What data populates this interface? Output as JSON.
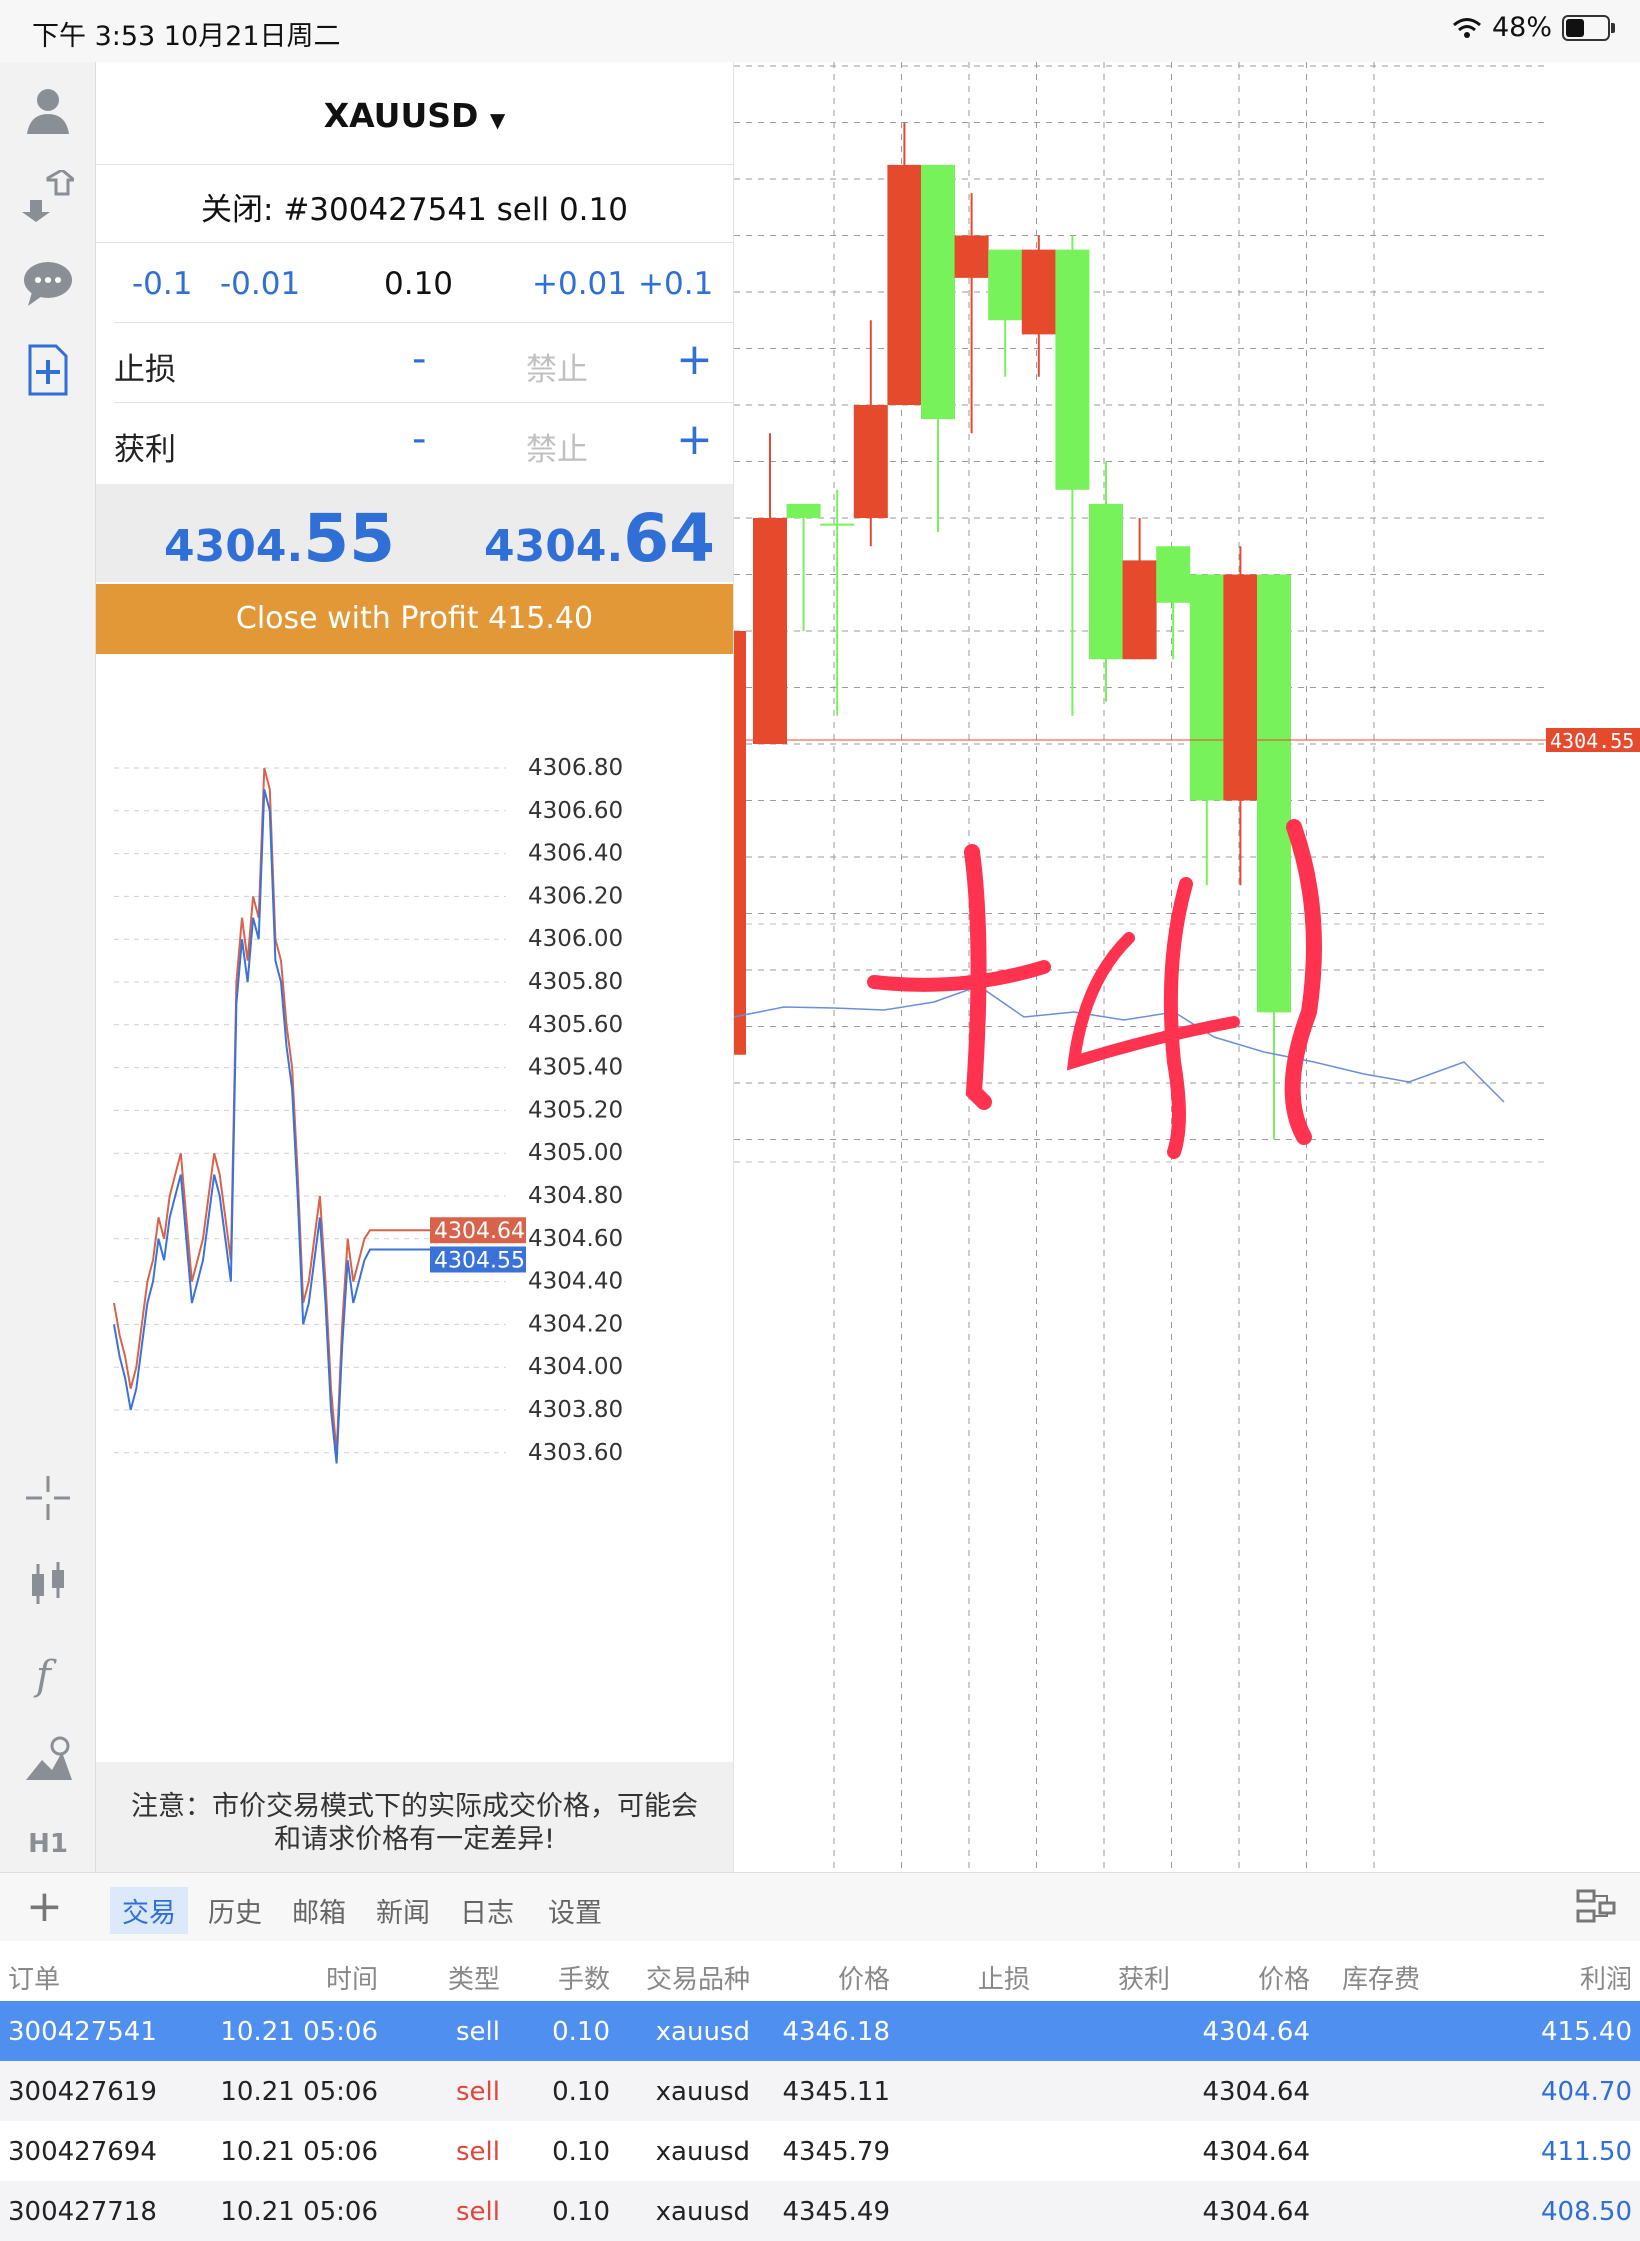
{
  "status_bar": {
    "time": "下午 3:53   10月21日周二",
    "battery_pct": "48%"
  },
  "toolbar": {
    "timeframe": "H1"
  },
  "order": {
    "symbol": "XAUUSD",
    "close_line": "关闭: #300427541 sell 0.10",
    "volume": {
      "dec_large": "-0.1",
      "dec_small": "-0.01",
      "value": "0.10",
      "inc_small": "+0.01",
      "inc_large": "+0.1"
    },
    "stop_loss": {
      "label": "止损",
      "minus": "-",
      "value": "禁止",
      "plus": "+"
    },
    "take_profit": {
      "label": "获利",
      "minus": "-",
      "value": "禁止",
      "plus": "+"
    },
    "bid": {
      "prefix": "4304.",
      "big": "55"
    },
    "ask": {
      "prefix": "4304.",
      "big": "64"
    },
    "close_button": "Close with Profit 415.40",
    "notice_line1": "注意：市价交易模式下的实际成交价格，可能会",
    "notice_line2": "和请求价格有一定差异!"
  },
  "tick_chart": {
    "y_ticks": [
      "4306.80",
      "4306.60",
      "4306.40",
      "4306.20",
      "4306.00",
      "4305.80",
      "4305.60",
      "4305.40",
      "4305.20",
      "4305.00",
      "4304.80",
      "4304.60",
      "4304.40",
      "4304.20",
      "4304.00",
      "4303.80",
      "4303.60"
    ],
    "ask_label": "4304.64",
    "bid_label": "4304.55",
    "ask_color": "#d9634a",
    "bid_color": "#3a72d8"
  },
  "candle_chart": {
    "price_label": "4304.55",
    "up_color": "#77f25a",
    "down_color": "#e64a2c",
    "handwriting": "+41"
  },
  "chart_data": {
    "type": "line",
    "title": "",
    "series": [
      {
        "name": "",
        "values": [
          4304.3,
          4304.15,
          4304.05,
          4303.9,
          4304.0,
          4304.2,
          4304.4,
          4304.5,
          4304.7,
          4304.6,
          4304.8,
          4304.9,
          4305.0,
          4304.7,
          4304.4,
          4304.5,
          4304.6,
          4304.8,
          4305.0,
          4304.9,
          4304.7,
          4304.5,
          4305.8,
          4306.1,
          4305.9,
          4306.2,
          4306.1,
          4306.8,
          4306.7,
          4306.0,
          4305.9,
          4305.6,
          4305.4,
          4304.9,
          4304.3,
          4304.4,
          4304.6,
          4304.8,
          4304.4,
          4303.9,
          4303.6,
          4304.2,
          4304.6,
          4304.4,
          4304.5,
          4304.6,
          4304.64
        ]
      },
      {
        "name": "",
        "values": [
          4304.2,
          4304.05,
          4303.95,
          4303.8,
          4303.9,
          4304.1,
          4304.3,
          4304.4,
          4304.6,
          4304.5,
          4304.7,
          4304.8,
          4304.9,
          4304.6,
          4304.3,
          4304.4,
          4304.5,
          4304.7,
          4304.9,
          4304.8,
          4304.6,
          4304.4,
          4305.7,
          4306.0,
          4305.8,
          4306.1,
          4306.0,
          4306.7,
          4306.6,
          4305.9,
          4305.8,
          4305.5,
          4305.3,
          4304.8,
          4304.2,
          4304.3,
          4304.5,
          4304.7,
          4304.3,
          4303.8,
          4303.55,
          4304.1,
          4304.5,
          4304.3,
          4304.4,
          4304.5,
          4304.55
        ]
      }
    ],
    "ylim": [
      4303.5,
      4306.9
    ],
    "grid": true
  },
  "candles": [
    {
      "o": 4305.9,
      "h": 4305.9,
      "l": 4304.4,
      "c": 4304.4
    },
    {
      "o": 4306.3,
      "h": 4306.6,
      "l": 4305.5,
      "c": 4305.5
    },
    {
      "o": 4306.3,
      "h": 4306.3,
      "l": 4305.9,
      "c": 4306.35
    },
    {
      "o": 4306.28,
      "h": 4306.4,
      "l": 4305.6,
      "c": 4306.28
    },
    {
      "o": 4306.7,
      "h": 4307.0,
      "l": 4306.2,
      "c": 4306.3
    },
    {
      "o": 4307.55,
      "h": 4307.7,
      "l": 4306.7,
      "c": 4306.7
    },
    {
      "o": 4306.65,
      "h": 4307.55,
      "l": 4306.25,
      "c": 4307.55
    },
    {
      "o": 4307.3,
      "h": 4307.45,
      "l": 4306.6,
      "c": 4307.15
    },
    {
      "o": 4307.0,
      "h": 4307.2,
      "l": 4306.8,
      "c": 4307.25
    },
    {
      "o": 4307.25,
      "h": 4307.3,
      "l": 4306.8,
      "c": 4306.95
    },
    {
      "o": 4306.4,
      "h": 4307.3,
      "l": 4305.6,
      "c": 4307.25
    },
    {
      "o": 4305.8,
      "h": 4306.5,
      "l": 4305.65,
      "c": 4306.35
    },
    {
      "o": 4306.15,
      "h": 4306.3,
      "l": 4305.8,
      "c": 4305.8
    },
    {
      "o": 4306.0,
      "h": 4306.2,
      "l": 4305.8,
      "c": 4306.2
    },
    {
      "o": 4305.3,
      "h": 4306.1,
      "l": 4305.0,
      "c": 4306.1
    },
    {
      "o": 4306.1,
      "h": 4306.2,
      "l": 4305.0,
      "c": 4305.3
    },
    {
      "o": 4304.55,
      "h": 4306.1,
      "l": 4304.1,
      "c": 4306.1
    }
  ],
  "tabs": [
    "交易",
    "历史",
    "邮箱",
    "新闻",
    "日志",
    "设置"
  ],
  "table": {
    "headers": [
      "订单",
      "时间",
      "类型",
      "手数",
      "交易品种",
      "价格",
      "止损",
      "获利",
      "价格",
      "库存费",
      "利润"
    ],
    "rows": [
      {
        "order": "300427541",
        "time": "10.21 05:06",
        "type": "sell",
        "lots": "0.10",
        "symbol": "xauusd",
        "open": "4346.18",
        "sl": "",
        "tp": "",
        "price": "4304.64",
        "swap": "",
        "profit": "415.40",
        "selected": true
      },
      {
        "order": "300427619",
        "time": "10.21 05:06",
        "type": "sell",
        "lots": "0.10",
        "symbol": "xauusd",
        "open": "4345.11",
        "sl": "",
        "tp": "",
        "price": "4304.64",
        "swap": "",
        "profit": "404.70",
        "selected": false
      },
      {
        "order": "300427694",
        "time": "10.21 05:06",
        "type": "sell",
        "lots": "0.10",
        "symbol": "xauusd",
        "open": "4345.79",
        "sl": "",
        "tp": "",
        "price": "4304.64",
        "swap": "",
        "profit": "411.50",
        "selected": false
      },
      {
        "order": "300427718",
        "time": "10.21 05:06",
        "type": "sell",
        "lots": "0.10",
        "symbol": "xauusd",
        "open": "4345.49",
        "sl": "",
        "tp": "",
        "price": "4304.64",
        "swap": "",
        "profit": "408.50",
        "selected": false
      }
    ]
  }
}
